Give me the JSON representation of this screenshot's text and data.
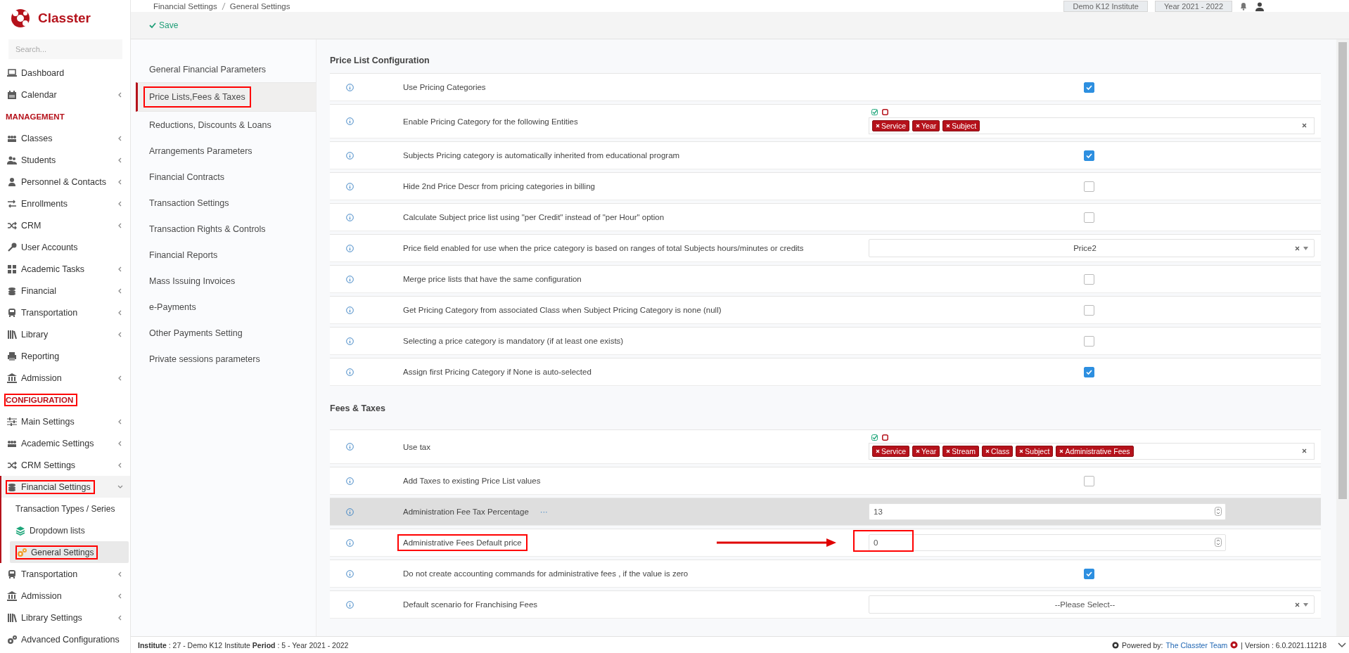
{
  "sidebar": {
    "logo": "Classter",
    "search": {
      "placeholder": "Search..."
    },
    "items": [
      {
        "kind": "link",
        "label": "Dashboard",
        "selected": false,
        "highlighted": false
      },
      {
        "kind": "group",
        "label": "Calendar",
        "selected": false,
        "expanded": false,
        "highlighted": false
      },
      {
        "kind": "header",
        "label": "MANAGEMENT",
        "highlighted": false
      },
      {
        "kind": "group",
        "label": "Classes",
        "selected": false,
        "expanded": false,
        "highlighted": false
      },
      {
        "kind": "group",
        "label": "Students",
        "selected": false,
        "expanded": false,
        "highlighted": false
      },
      {
        "kind": "group",
        "label": "Personnel & Contacts",
        "selected": false,
        "expanded": false,
        "highlighted": false
      },
      {
        "kind": "group",
        "label": "Enrollments",
        "selected": false,
        "expanded": false,
        "highlighted": false
      },
      {
        "kind": "group",
        "label": "CRM",
        "selected": false,
        "expanded": false,
        "highlighted": false
      },
      {
        "kind": "link",
        "label": "User Accounts",
        "selected": false,
        "highlighted": false
      },
      {
        "kind": "group",
        "label": "Academic Tasks",
        "selected": false,
        "expanded": false,
        "highlighted": false
      },
      {
        "kind": "group",
        "label": "Financial",
        "selected": false,
        "expanded": false,
        "highlighted": false
      },
      {
        "kind": "group",
        "label": "Transportation",
        "selected": false,
        "expanded": false,
        "highlighted": false
      },
      {
        "kind": "group",
        "label": "Library",
        "selected": false,
        "expanded": false,
        "highlighted": false
      },
      {
        "kind": "link",
        "label": "Reporting",
        "selected": false,
        "highlighted": false
      },
      {
        "kind": "group",
        "label": "Admission",
        "selected": false,
        "expanded": false,
        "highlighted": false
      },
      {
        "kind": "header",
        "label": "CONFIGURATION",
        "highlighted": true
      },
      {
        "kind": "group",
        "label": "Main Settings",
        "selected": false,
        "expanded": false,
        "highlighted": false
      },
      {
        "kind": "group",
        "label": "Academic Settings",
        "selected": false,
        "expanded": false,
        "highlighted": false
      },
      {
        "kind": "group",
        "label": "CRM Settings",
        "selected": false,
        "expanded": false,
        "highlighted": false
      },
      {
        "kind": "group",
        "label": "Financial Settings",
        "selected": false,
        "expanded": true,
        "highlighted": true,
        "children": [
          {
            "kind": "subitem",
            "label": "Transaction Types / Series",
            "selected": false,
            "highlighted": false
          },
          {
            "kind": "subitem",
            "label": "Dropdown lists",
            "selected": false,
            "highlighted": false
          },
          {
            "kind": "subitem",
            "label": "General Settings",
            "selected": true,
            "highlighted": true
          }
        ]
      },
      {
        "kind": "group",
        "label": "Transportation",
        "selected": false,
        "expanded": false,
        "highlighted": false
      },
      {
        "kind": "group",
        "label": "Admission",
        "selected": false,
        "expanded": false,
        "highlighted": false
      },
      {
        "kind": "group",
        "label": "Library Settings",
        "selected": false,
        "expanded": false,
        "highlighted": false
      },
      {
        "kind": "link",
        "label": "Advanced Configurations",
        "selected": false,
        "highlighted": false
      }
    ]
  },
  "header": {
    "breadcrumbs": [
      "Financial Settings",
      "General Settings"
    ],
    "institute": "Demo K12 Institute",
    "period": "Year 2021 - 2022",
    "save": "Save"
  },
  "settings_nav": [
    {
      "label": "General Financial Parameters",
      "selected": false,
      "highlighted": false
    },
    {
      "label": "Price Lists,Fees & Taxes",
      "selected": true,
      "highlighted": true
    },
    {
      "label": "Reductions, Discounts & Loans",
      "selected": false,
      "highlighted": false
    },
    {
      "label": "Arrangements Parameters",
      "selected": false,
      "highlighted": false
    },
    {
      "label": "Financial Contracts",
      "selected": false,
      "highlighted": false
    },
    {
      "label": "Transaction Settings",
      "selected": false,
      "highlighted": false
    },
    {
      "label": "Transaction Rights & Controls",
      "selected": false,
      "highlighted": false
    },
    {
      "label": "Financial Reports",
      "selected": false,
      "highlighted": false
    },
    {
      "label": "Mass Issuing Invoices",
      "selected": false,
      "highlighted": false
    },
    {
      "label": "e-Payments",
      "selected": false,
      "highlighted": false
    },
    {
      "label": "Other Payments Setting",
      "selected": false,
      "highlighted": false
    },
    {
      "label": "Private sessions parameters",
      "selected": false,
      "highlighted": false
    }
  ],
  "sections": [
    {
      "title": "Price List Configuration",
      "rows": [
        {
          "kind": "checkbox",
          "label": "Use Pricing Categories",
          "checked": true,
          "hovered": false,
          "highlighted": false
        },
        {
          "kind": "tags",
          "label": "Enable Pricing Category for the following Entities",
          "tags": [
            "Service",
            "Year",
            "Subject"
          ],
          "hovered": false,
          "highlighted": false
        },
        {
          "kind": "checkbox",
          "label": "Subjects Pricing category is automatically inherited from educational program",
          "checked": true,
          "hovered": false,
          "highlighted": false
        },
        {
          "kind": "checkbox",
          "label": "Hide 2nd Price Descr from pricing categories in billing",
          "checked": false,
          "hovered": false,
          "highlighted": false
        },
        {
          "kind": "checkbox",
          "label": "Calculate Subject price list using \"per Credit\" instead of \"per Hour\" option",
          "checked": false,
          "hovered": false,
          "highlighted": false
        },
        {
          "kind": "select",
          "label": "Price field enabled for use when the price category is based on ranges of total Subjects hours/minutes or credits",
          "value": "Price2",
          "hovered": false,
          "highlighted": false
        },
        {
          "kind": "checkbox",
          "label": "Merge price lists that have the same configuration",
          "checked": false,
          "hovered": false,
          "highlighted": false
        },
        {
          "kind": "checkbox",
          "label": "Get Pricing Category from associated Class when Subject Pricing Category is none (null)",
          "checked": false,
          "hovered": false,
          "highlighted": false
        },
        {
          "kind": "checkbox",
          "label": "Selecting a price category is mandatory (if at least one exists)",
          "checked": false,
          "hovered": false,
          "highlighted": false
        },
        {
          "kind": "checkbox",
          "label": "Assign first Pricing Category if None is auto-selected",
          "checked": true,
          "hovered": false,
          "highlighted": false
        }
      ]
    },
    {
      "title": "Fees & Taxes",
      "rows": [
        {
          "kind": "tags",
          "label": "Use tax",
          "tags": [
            "Service",
            "Year",
            "Stream",
            "Class",
            "Subject",
            "Administrative Fees"
          ],
          "hovered": false,
          "highlighted": false
        },
        {
          "kind": "checkbox",
          "label": "Add Taxes to existing Price List values",
          "checked": false,
          "hovered": false,
          "highlighted": false
        },
        {
          "kind": "number",
          "label": "Administration Fee Tax Percentage",
          "more": "···",
          "value": "13",
          "hovered": true,
          "highlighted": false
        },
        {
          "kind": "number",
          "label": "Administrative Fees Default price",
          "value": "0",
          "hovered": false,
          "highlighted": true
        },
        {
          "kind": "checkbox",
          "label": "Do not create accounting commands for administrative fees , if the value is zero",
          "checked": true,
          "hovered": false,
          "highlighted": false
        },
        {
          "kind": "select",
          "label": "Default scenario for Franchising Fees",
          "placeholder": "--Please Select--",
          "hovered": false,
          "highlighted": false
        }
      ]
    }
  ],
  "footer": {
    "context": "**Institute** : 27 - Demo K12 Institute **Period** : 5 - Year 2021 - 2022",
    "powered_by": "Powered by:",
    "team": "The Classter Team",
    "version": "| Version : 6.0.2021.11218"
  }
}
